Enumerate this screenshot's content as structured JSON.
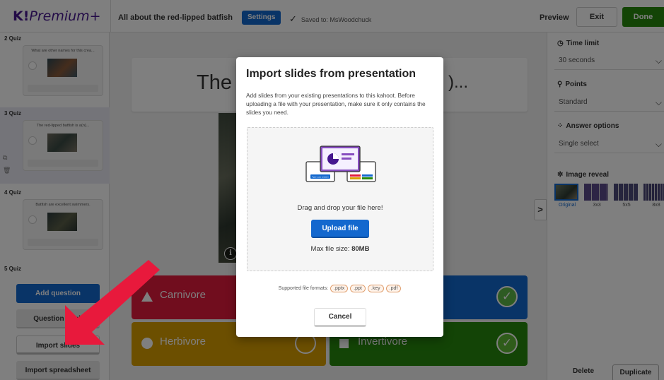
{
  "app": {
    "logo_main": "K!",
    "logo_suffix": "Premium+",
    "kahoot_title": "All about the red-lipped batfish",
    "settings_label": "Settings",
    "saved_text": "Saved to: MsWoodchuck",
    "preview_label": "Preview",
    "exit_label": "Exit",
    "done_label": "Done"
  },
  "sidebar": {
    "slides": [
      {
        "num": "2  Quiz",
        "text": "What are other names for this crea..."
      },
      {
        "num": "3  Quiz",
        "text": "The red-lipped batfish is a(n)..."
      },
      {
        "num": "4  Quiz",
        "text": "Batfish are excellent swimmers."
      },
      {
        "num": "5  Quiz",
        "text": ""
      }
    ],
    "add_question": "Add question",
    "question_bank": "Question bank",
    "import_slides": "Import slides",
    "import_spreadsheet": "Import spreadsheet"
  },
  "editor": {
    "question_visible": "The",
    "question_tail": ")...",
    "answers": [
      {
        "label": "Carnivore",
        "color": "#e21b3c",
        "shape": "triangle",
        "correct": true
      },
      {
        "label": "",
        "color": "#1368ce",
        "shape": "diamond",
        "correct": true
      },
      {
        "label": "Herbivore",
        "color": "#d89e00",
        "shape": "circle",
        "correct": false
      },
      {
        "label": "Invertivore",
        "color": "#26890c",
        "shape": "square",
        "correct": true
      }
    ],
    "info_symbol": "i",
    "collapse_symbol": ">"
  },
  "settings_panel": {
    "time_limit_label": "Time limit",
    "time_limit_value": "30 seconds",
    "points_label": "Points",
    "points_value": "Standard",
    "answer_options_label": "Answer options",
    "answer_options_value": "Single select",
    "image_reveal_label": "Image reveal",
    "reveal_options": [
      "Original",
      "3x3",
      "5x5",
      "8x8"
    ],
    "reveal_selected": "Original",
    "delete_label": "Delete",
    "duplicate_label": "Duplicate"
  },
  "modal": {
    "title": "Import slides from presentation",
    "description": "Add slides from your existing presentations to this kahoot. Before uploading a file with your presentation, make sure it only contains the slides you need.",
    "illustration_caption": "Type your answer",
    "drop_text": "Drag and drop your file here!",
    "upload_label": "Upload file",
    "size_prefix": "Max file size: ",
    "size_value": "80MB",
    "formats_label": "Supported file formats:",
    "formats": [
      ".pptx",
      ".ppt",
      ".key",
      ".pdf"
    ],
    "cancel_label": "Cancel"
  },
  "colors": {
    "brand": "#46178f",
    "primary": "#1368ce",
    "done": "#26890c",
    "annotation_arrow": "#e8193c"
  }
}
